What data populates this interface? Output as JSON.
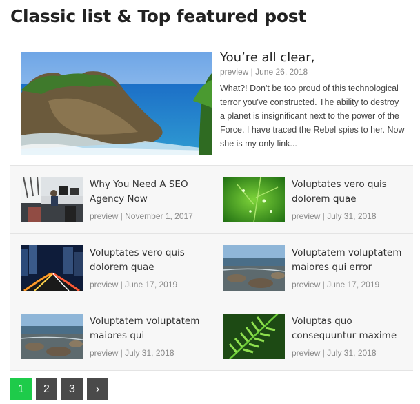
{
  "heading": "Classic list & Top featured post",
  "featured": {
    "title": "You’re all clear,",
    "meta": "preview | June 26, 2018",
    "excerpt": "What?! Don't be too proud of this technological terror you've constructed. The ability to destroy a planet is insignificant next to the power of the Force. I have traced the Rebel spies to her. Now she is my only link..."
  },
  "posts": [
    {
      "title": "Why You Need A SEO Agency Now",
      "meta": "preview | November 1, 2017",
      "image": "office"
    },
    {
      "title": "Voluptates vero quis dolorem quae",
      "meta": "preview | July 31, 2018",
      "image": "green-leaf"
    },
    {
      "title": "Voluptates vero quis dolorem quae",
      "meta": "preview | June 17, 2019",
      "image": "city-night"
    },
    {
      "title": "Voluptatem voluptatem maiores qui error",
      "meta": "preview | June 17, 2019",
      "image": "rocky-shore"
    },
    {
      "title": "Voluptatem voluptatem maiores qui",
      "meta": "preview | July 31, 2018",
      "image": "rocky-shore"
    },
    {
      "title": "Voluptas quo consequuntur maxime",
      "meta": "preview | July 31, 2018",
      "image": "fern"
    }
  ],
  "pagination": {
    "pages": [
      "1",
      "2",
      "3"
    ],
    "current": "1",
    "next_symbol": "›",
    "active_color": "#1ecb4a",
    "inactive_color": "#4a4a4a"
  }
}
